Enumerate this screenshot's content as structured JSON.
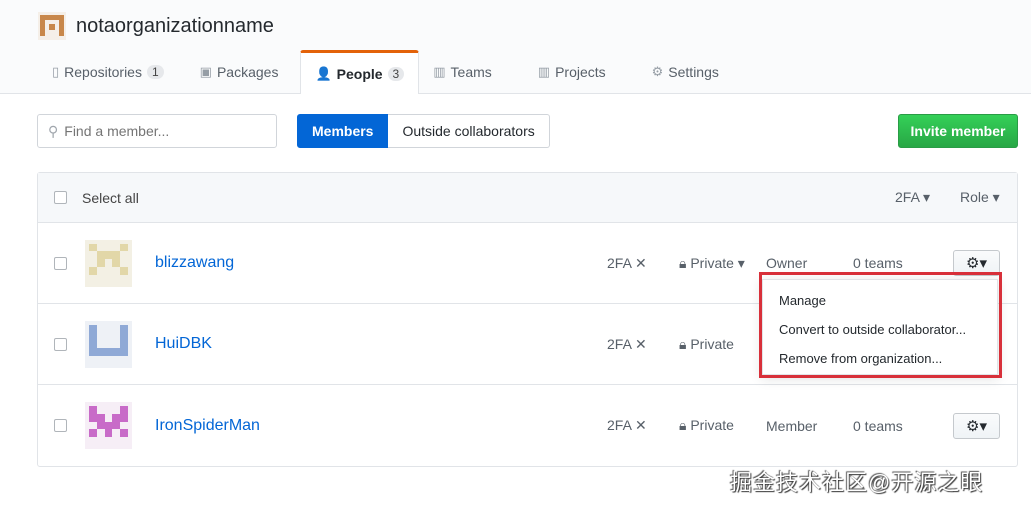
{
  "org": {
    "name": "notaorganizationname"
  },
  "tabs": [
    {
      "label": "Repositories",
      "count": "1",
      "icon": "repo-icon"
    },
    {
      "label": "Packages",
      "icon": "package-icon"
    },
    {
      "label": "People",
      "count": "3",
      "icon": "person-icon",
      "selected": true
    },
    {
      "label": "Teams",
      "icon": "jersey-icon"
    },
    {
      "label": "Projects",
      "icon": "project-icon"
    },
    {
      "label": "Settings",
      "icon": "gear-icon"
    }
  ],
  "search": {
    "placeholder": "Find a member..."
  },
  "filter": {
    "members": "Members",
    "outside": "Outside collaborators"
  },
  "invite_label": "Invite member",
  "table_header": {
    "select_all": "Select all",
    "twofa": "2FA ▾",
    "role": "Role ▾"
  },
  "members": [
    {
      "username": "blizzawang",
      "twofa": "2FA ✕",
      "visibility": "Private ▾",
      "role": "Owner",
      "teams": "0 teams"
    },
    {
      "username": "HuiDBK",
      "twofa": "2FA ✕",
      "visibility": "Private",
      "role": "",
      "teams": ""
    },
    {
      "username": "IronSpiderMan",
      "twofa": "2FA ✕",
      "visibility": "Private",
      "role": "Member",
      "teams": "0 teams"
    }
  ],
  "menu": [
    "Manage",
    "Convert to outside collaborator...",
    "Remove from organization..."
  ],
  "watermark": "掘金技术社区@开源之眼",
  "colors": {
    "accent": "#0366d6",
    "tab_indicator": "#e36209",
    "invite": "#28a745",
    "highlight": "#d8303a"
  }
}
